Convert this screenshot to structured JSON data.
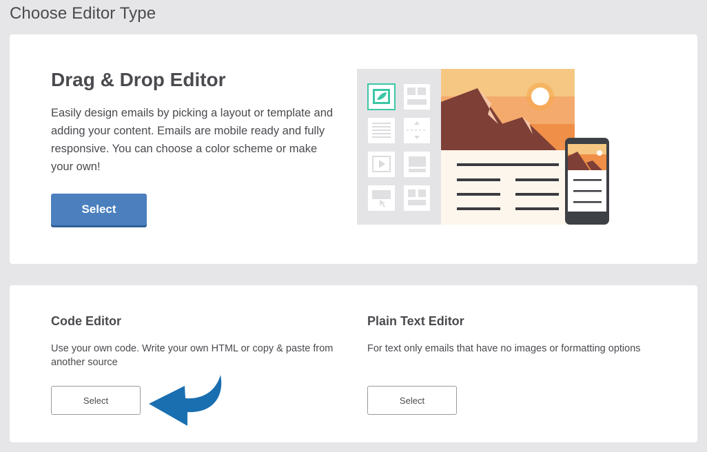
{
  "page": {
    "title": "Choose Editor Type"
  },
  "drag_drop": {
    "title": "Drag & Drop Editor",
    "description": "Easily design emails by picking a layout or template and adding your content. Emails are mobile ready and fully responsive. You can choose a color scheme or make your own!",
    "select_label": "Select"
  },
  "code_editor": {
    "title": "Code Editor",
    "description": "Use your own code. Write your own HTML or copy & paste from another source",
    "select_label": "Select"
  },
  "plain_text_editor": {
    "title": "Plain Text Editor",
    "description": "For text only emails that have no images or formatting options",
    "select_label": "Select"
  },
  "icons": {
    "illustration": "email-editor-illustration",
    "arrow": "curved-arrow-icon"
  },
  "colors": {
    "primary_button": "#4b7fbe",
    "arrow": "#1a6fb0",
    "accent_teal": "#3cc7a5"
  }
}
